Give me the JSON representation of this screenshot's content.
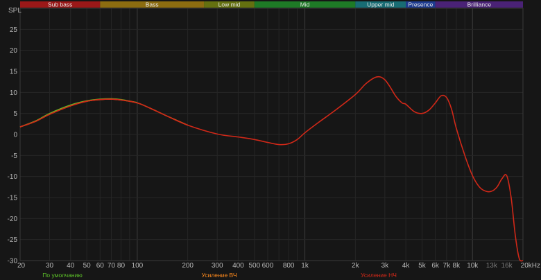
{
  "colors": {
    "background": "#161616",
    "grid": "#262626",
    "grid_major": "#3c3c3c",
    "axis_text": "#b8b8b8",
    "curve_main": "#d02818",
    "curve_hf_boost": "#ff8a1c",
    "curve_default": "#5cc028"
  },
  "chart_data": {
    "type": "line",
    "title": "",
    "ylabel": "SPL",
    "xlabel": "",
    "x_scale": "log",
    "xlim": [
      20,
      20000
    ],
    "ylim": [
      -30,
      30
    ],
    "grid": true,
    "x_ticks": [
      {
        "value": 20,
        "label": "20"
      },
      {
        "value": 30,
        "label": "30"
      },
      {
        "value": 40,
        "label": "40"
      },
      {
        "value": 50,
        "label": "50"
      },
      {
        "value": 60,
        "label": "60"
      },
      {
        "value": 70,
        "label": "70"
      },
      {
        "value": 80,
        "label": "80"
      },
      {
        "value": 100,
        "label": "100"
      },
      {
        "value": 200,
        "label": "200"
      },
      {
        "value": 300,
        "label": "300"
      },
      {
        "value": 400,
        "label": "400"
      },
      {
        "value": 500,
        "label": "500"
      },
      {
        "value": 600,
        "label": "600"
      },
      {
        "value": 800,
        "label": "800"
      },
      {
        "value": 1000,
        "label": "1k"
      },
      {
        "value": 2000,
        "label": "2k"
      },
      {
        "value": 3000,
        "label": "3k"
      },
      {
        "value": 4000,
        "label": "4k"
      },
      {
        "value": 5000,
        "label": "5k"
      },
      {
        "value": 6000,
        "label": "6k"
      },
      {
        "value": 7000,
        "label": "7k"
      },
      {
        "value": 8000,
        "label": "8k"
      },
      {
        "value": 10000,
        "label": "10k"
      },
      {
        "value": 13000,
        "label": "13k"
      },
      {
        "value": 16000,
        "label": "16k"
      },
      {
        "value": 20000,
        "label": "20kHz"
      }
    ],
    "y_ticks": [
      25,
      20,
      15,
      10,
      5,
      0,
      -5,
      -10,
      -15,
      -20,
      -25,
      -30
    ],
    "bands": [
      {
        "label": "Sub bass",
        "from": 20,
        "to": 60,
        "color": "#9a1818"
      },
      {
        "label": "Bass",
        "from": 60,
        "to": 250,
        "color": "#8c6c10"
      },
      {
        "label": "Low mid",
        "from": 250,
        "to": 500,
        "color": "#647010"
      },
      {
        "label": "Mid",
        "from": 500,
        "to": 2000,
        "color": "#1e7a26"
      },
      {
        "label": "Upper mid",
        "from": 2000,
        "to": 4000,
        "color": "#186c74"
      },
      {
        "label": "Presence",
        "from": 4000,
        "to": 6000,
        "color": "#1e3c90"
      },
      {
        "label": "Brilliance",
        "from": 6000,
        "to": 20000,
        "color": "#4a2276"
      }
    ],
    "series": [
      {
        "name": "По умолчанию",
        "color": "#5cc028",
        "x": [
          20,
          25,
          30,
          40,
          50,
          60,
          70,
          80,
          100
        ],
        "y": [
          1.8,
          3.3,
          5.0,
          7.0,
          8.0,
          8.4,
          8.5,
          8.3,
          7.6
        ]
      },
      {
        "name": "Усиление ВЧ",
        "color": "#ff8a1c",
        "x": [
          20,
          25,
          30,
          40,
          50,
          60,
          70,
          80,
          100,
          120,
          150,
          200
        ],
        "y": [
          1.8,
          3.2,
          4.8,
          6.8,
          7.9,
          8.3,
          8.4,
          8.2,
          7.5,
          6.2,
          4.4,
          2.2
        ]
      },
      {
        "name": "Усиление НЧ",
        "color": "#d02818",
        "x": [
          20,
          25,
          30,
          40,
          50,
          60,
          70,
          80,
          100,
          120,
          150,
          200,
          300,
          400,
          500,
          600,
          700,
          800,
          900,
          1000,
          1200,
          1500,
          2000,
          2300,
          2600,
          2800,
          3000,
          3200,
          3500,
          3800,
          4000,
          4500,
          5000,
          5500,
          6000,
          6500,
          7000,
          7500,
          8000,
          9000,
          10000,
          11000,
          12000,
          13000,
          14000,
          15000,
          16000,
          17000,
          18000,
          19000,
          20000
        ],
        "y": [
          1.8,
          3.2,
          4.8,
          6.8,
          7.9,
          8.3,
          8.4,
          8.2,
          7.5,
          6.2,
          4.4,
          2.2,
          0.1,
          -0.6,
          -1.2,
          -1.9,
          -2.4,
          -2.2,
          -1.2,
          0.4,
          2.8,
          5.6,
          9.5,
          12.0,
          13.5,
          13.7,
          13.0,
          11.5,
          9.0,
          7.5,
          7.2,
          5.4,
          5.0,
          5.8,
          7.5,
          9.2,
          8.8,
          6.0,
          1.5,
          -5.0,
          -9.8,
          -12.5,
          -13.5,
          -13.5,
          -12.5,
          -10.5,
          -9.8,
          -15.0,
          -24.0,
          -29.5,
          -31.0
        ]
      }
    ]
  }
}
